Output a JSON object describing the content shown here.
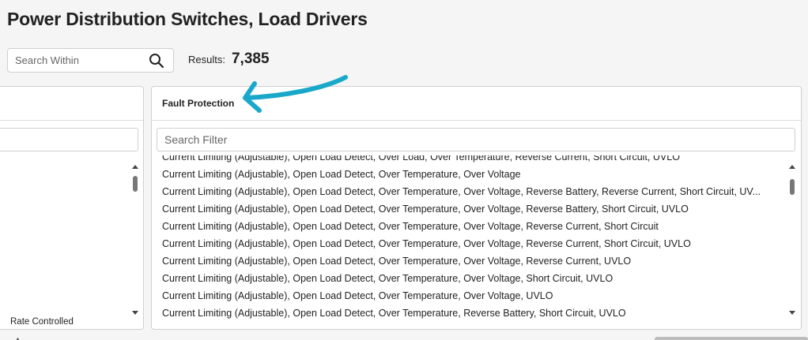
{
  "page_title": "Power Distribution Switches, Load Drivers",
  "search_within": {
    "placeholder": "Search Within"
  },
  "results": {
    "label": "Results:",
    "count": "7,385"
  },
  "left_panel": {
    "visible_item_fragment": "Rate Controlled"
  },
  "fault_panel": {
    "header": "Fault Protection",
    "filter_placeholder": "Search Filter",
    "items": [
      "Current Limiting (Adjustable), Open Load Detect, Over Load, Over Temperature, Reverse Current, Short Circuit, UVLO",
      "Current Limiting (Adjustable), Open Load Detect, Over Temperature, Over Voltage",
      "Current Limiting (Adjustable), Open Load Detect, Over Temperature, Over Voltage, Reverse Battery, Reverse Current, Short Circuit, UV...",
      "Current Limiting (Adjustable), Open Load Detect, Over Temperature, Over Voltage, Reverse Battery, Short Circuit, UVLO",
      "Current Limiting (Adjustable), Open Load Detect, Over Temperature, Over Voltage, Reverse Current, Short Circuit",
      "Current Limiting (Adjustable), Open Load Detect, Over Temperature, Over Voltage, Reverse Current, Short Circuit, UVLO",
      "Current Limiting (Adjustable), Open Load Detect, Over Temperature, Over Voltage, Reverse Current, UVLO",
      "Current Limiting (Adjustable), Open Load Detect, Over Temperature, Over Voltage, Short Circuit, UVLO",
      "Current Limiting (Adjustable), Open Load Detect, Over Temperature, Over Voltage, UVLO",
      "Current Limiting (Adjustable), Open Load Detect, Over Temperature, Reverse Battery, Short Circuit, UVLO"
    ]
  },
  "icons": {
    "search": "search-icon",
    "annotation": "arrow-annotation-icon"
  },
  "colors": {
    "annotation_arrow": "#19a8c9",
    "page_background": "#f5f5f5"
  }
}
